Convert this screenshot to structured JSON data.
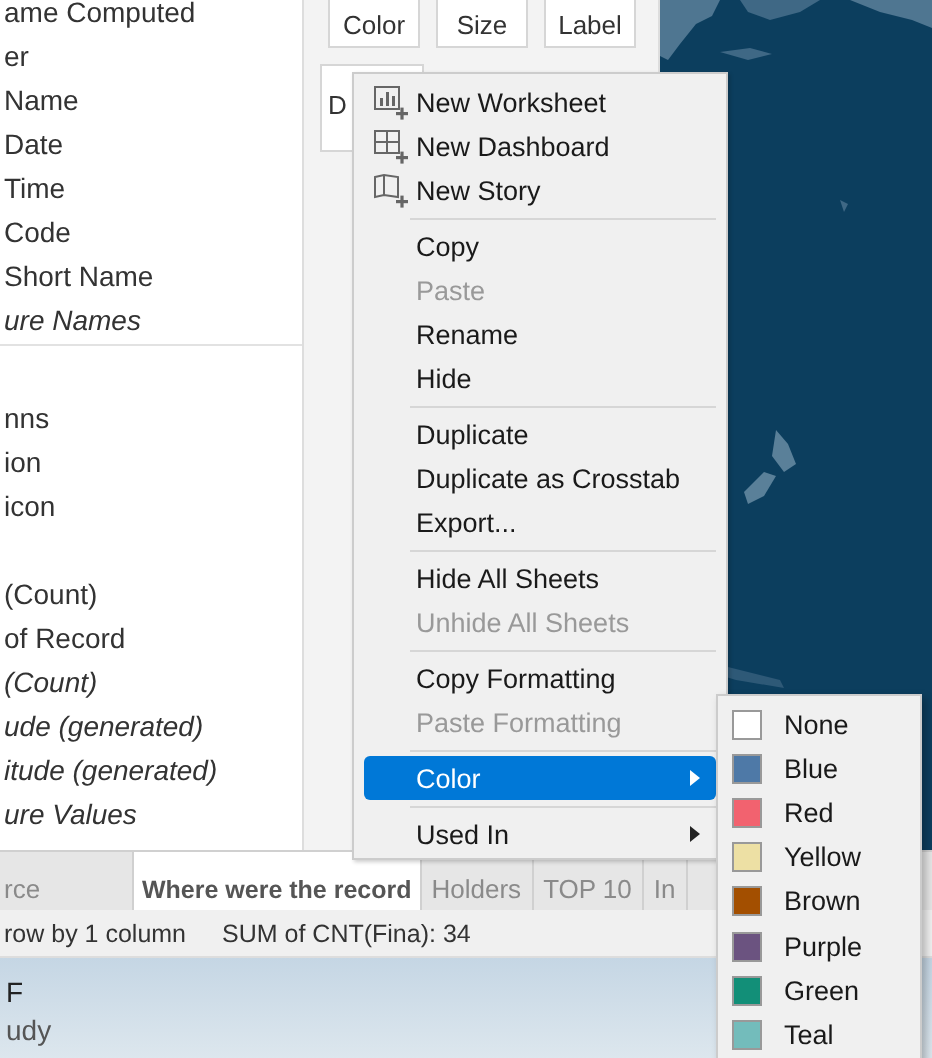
{
  "data_pane": {
    "sections": [
      {
        "items": [
          {
            "label": "ame Computed",
            "italic": false
          },
          {
            "label": "er",
            "italic": false
          },
          {
            "label": "Name",
            "italic": false
          },
          {
            "label": "Date",
            "italic": false
          },
          {
            "label": "Time",
            "italic": false
          },
          {
            "label": "Code",
            "italic": false
          },
          {
            "label": "Short Name",
            "italic": false
          },
          {
            "label": "ure Names",
            "italic": true
          }
        ]
      },
      {
        "items": [
          {
            "label": "nns",
            "italic": false
          },
          {
            "label": "ion",
            "italic": false
          },
          {
            "label": "icon",
            "italic": false
          }
        ]
      },
      {
        "items": [
          {
            "label": "(Count)",
            "italic": false
          },
          {
            "label": "of Record",
            "italic": false
          },
          {
            "label": "(Count)",
            "italic": true
          },
          {
            "label": "ude (generated)",
            "italic": true
          },
          {
            "label": "itude (generated)",
            "italic": true
          },
          {
            "label": "ure Values",
            "italic": true
          }
        ]
      }
    ]
  },
  "marks_card": {
    "buttons": [
      "Color",
      "Size",
      "Label"
    ],
    "second_row": [
      "D"
    ]
  },
  "map": {
    "kind": "picture"
  },
  "context_menu": {
    "groups": [
      [
        {
          "label": "New Worksheet",
          "disabled": false,
          "highlighted": false,
          "submenu": false
        },
        {
          "label": "New Dashboard",
          "disabled": false,
          "highlighted": false,
          "submenu": false
        },
        {
          "label": "New Story",
          "disabled": false,
          "highlighted": false,
          "submenu": false
        }
      ],
      [
        {
          "label": "Copy",
          "disabled": false,
          "highlighted": false,
          "submenu": false
        },
        {
          "label": "Paste",
          "disabled": true,
          "highlighted": false,
          "submenu": false
        },
        {
          "label": "Rename",
          "disabled": false,
          "highlighted": false,
          "submenu": false
        },
        {
          "label": "Hide",
          "disabled": false,
          "highlighted": false,
          "submenu": false
        }
      ],
      [
        {
          "label": "Duplicate",
          "disabled": false,
          "highlighted": false,
          "submenu": false
        },
        {
          "label": "Duplicate as Crosstab",
          "disabled": false,
          "highlighted": false,
          "submenu": false
        },
        {
          "label": "Export...",
          "disabled": false,
          "highlighted": false,
          "submenu": false
        }
      ],
      [
        {
          "label": "Hide All Sheets",
          "disabled": false,
          "highlighted": false,
          "submenu": false
        },
        {
          "label": "Unhide All Sheets",
          "disabled": true,
          "highlighted": false,
          "submenu": false
        }
      ],
      [
        {
          "label": "Copy Formatting",
          "disabled": false,
          "highlighted": false,
          "submenu": false
        },
        {
          "label": "Paste Formatting",
          "disabled": true,
          "highlighted": false,
          "submenu": false
        }
      ],
      [
        {
          "label": "Color",
          "disabled": false,
          "highlighted": true,
          "submenu": true
        }
      ],
      [
        {
          "label": "Used In",
          "disabled": false,
          "highlighted": false,
          "submenu": true
        }
      ]
    ]
  },
  "color_submenu": [
    {
      "label": "None",
      "color": "#ffffff"
    },
    {
      "label": "Blue",
      "color": "#4e79a7"
    },
    {
      "label": "Red",
      "color": "#f2626f"
    },
    {
      "label": "Yellow",
      "color": "#ede0a4"
    },
    {
      "label": "Brown",
      "color": "#a34f00"
    },
    {
      "label": "Purple",
      "color": "#6b5380"
    },
    {
      "label": "Green",
      "color": "#128f78"
    },
    {
      "label": "Teal",
      "color": "#73bcbb"
    }
  ],
  "sheet_tabs": [
    {
      "label": "rce",
      "selected": false
    },
    {
      "label": "Where were the record",
      "selected": true
    },
    {
      "label": "Holders",
      "selected": false
    },
    {
      "label": "TOP 10",
      "selected": false
    },
    {
      "label": "In",
      "selected": false
    }
  ],
  "status_bar": [
    "row by 1 column",
    "SUM of CNT(Fina): 34"
  ],
  "notification": [
    "F",
    "udy"
  ]
}
